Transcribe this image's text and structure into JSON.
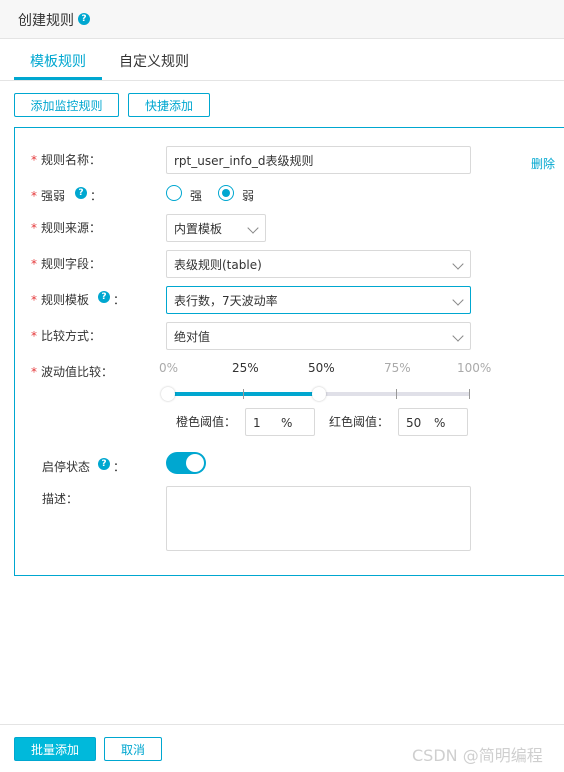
{
  "header": {
    "title": "创建规则",
    "help_icon": "question-circle-icon"
  },
  "tabs": [
    {
      "label": "模板规则",
      "active": true
    },
    {
      "label": "自定义规则",
      "active": false
    }
  ],
  "toolbar": {
    "add_monitor_rule": "添加监控规则",
    "quick_add": "快捷添加"
  },
  "form": {
    "delete_label": "删除",
    "required_mark": "*",
    "rule_name": {
      "label": "规则名称：",
      "value": "rpt_user_info_d表级规则"
    },
    "strength": {
      "label": "强弱",
      "colon": "：",
      "options": [
        "强",
        "弱"
      ],
      "selected": "弱"
    },
    "rule_source": {
      "label": "规则来源：",
      "value": "内置模板"
    },
    "rule_field": {
      "label": "规则字段：",
      "value": "表级规则(table)"
    },
    "rule_template": {
      "label": "规则模板",
      "colon": "：",
      "value": "表行数，7天波动率"
    },
    "compare_method": {
      "label": "比较方式：",
      "value": "绝对值"
    },
    "fluctuation": {
      "label": "波动值比较：",
      "ticks": [
        "0%",
        "25%",
        "50%",
        "75%",
        "100%"
      ],
      "range_low": 0,
      "range_high": 50,
      "orange_label": "橙色阈值：",
      "orange_value": "1",
      "red_label": "红色阈值：",
      "red_value": "50",
      "unit": "%"
    },
    "status": {
      "label": "启停状态",
      "colon": "：",
      "enabled": true
    },
    "description": {
      "label": "描述：",
      "value": ""
    }
  },
  "footer": {
    "batch_add": "批量添加",
    "cancel": "取消"
  },
  "watermark": "CSDN @简明编程",
  "colors": {
    "accent": "#00a7d0",
    "required": "#e5393b"
  }
}
